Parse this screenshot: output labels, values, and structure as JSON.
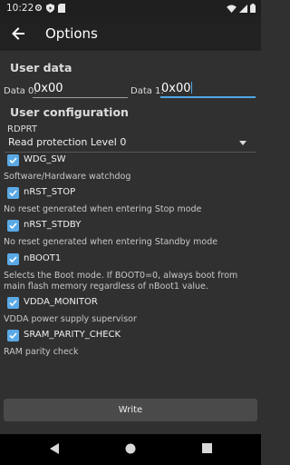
{
  "status_bar": {
    "time": "10:22",
    "icons": [
      "settings-icon",
      "play-protect-icon",
      "sd-card-icon",
      "wifi-icon",
      "signal-icon",
      "battery-icon"
    ]
  },
  "app_bar": {
    "title": "Options"
  },
  "user_data": {
    "heading": "User data",
    "data0_label": "Data 0:",
    "data0_value": "0x00",
    "data1_label": "Data 1:",
    "data1_value": "0x00"
  },
  "user_config": {
    "heading": "User configuration",
    "rdprt_label": "RDPRT",
    "rdprt_value": "Read protection Level 0",
    "options": [
      {
        "label": "WDG_SW",
        "checked": true,
        "description": "Software/Hardware watchdog"
      },
      {
        "label": "nRST_STOP",
        "checked": true,
        "description": "No reset generated when entering Stop mode"
      },
      {
        "label": "nRST_STDBY",
        "checked": true,
        "description": "No reset generated when entering Standby mode"
      },
      {
        "label": "nBOOT1",
        "checked": true,
        "description": "Selects the Boot mode. If BOOT0=0, always boot from main flash memory regardless of nBoot1 value."
      },
      {
        "label": "VDDA_MONITOR",
        "checked": true,
        "description": "VDDA power supply supervisor"
      },
      {
        "label": "SRAM_PARITY_CHECK",
        "checked": true,
        "description": "RAM parity check"
      }
    ]
  },
  "write_button": {
    "label": "Write"
  },
  "colors": {
    "accent": "#5aa9e6",
    "background": "#303030",
    "app_bar": "#212121"
  }
}
